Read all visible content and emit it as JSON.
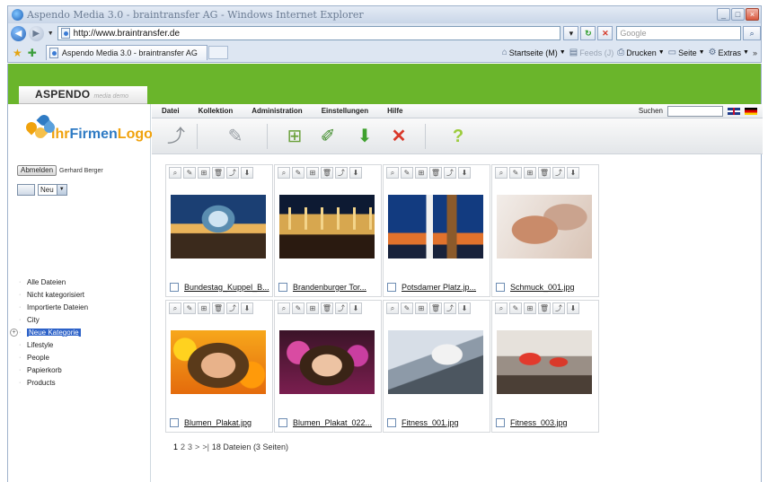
{
  "window": {
    "title": "Aspendo Media 3.0 - braintransfer AG - Windows Internet Explorer",
    "controls": {
      "minimize": "_",
      "maximize": "□",
      "close": "×"
    }
  },
  "browser": {
    "url": "http://www.braintransfer.de",
    "search_placeholder": "Google",
    "tab_title": "Aspendo Media 3.0 - braintransfer AG",
    "commands": {
      "home": "Startseite (M)",
      "feeds": "Feeds (J)",
      "print": "Drucken",
      "page": "Seite",
      "extras": "Extras"
    }
  },
  "app": {
    "brand": "ASPENDO",
    "brand_sub": "media demo",
    "logo": {
      "ihr": "Ihr",
      "firmen": "Firmen",
      "logo": "Logo"
    },
    "user": {
      "logout_label": "Abmelden",
      "name": "Gerhard Berger"
    },
    "new_select": "Neu",
    "menu": [
      "Datei",
      "Kollektion",
      "Administration",
      "Einstellungen",
      "Hilfe"
    ],
    "search_label": "Suchen",
    "tree": [
      {
        "label": "Alle Dateien",
        "selected": false
      },
      {
        "label": "Nicht kategorisiert",
        "selected": false
      },
      {
        "label": "Importierte Dateien",
        "selected": false
      },
      {
        "label": "City",
        "selected": false
      },
      {
        "label": "Neue Kategorie",
        "selected": true
      },
      {
        "label": "Lifestyle",
        "selected": false
      },
      {
        "label": "People",
        "selected": false
      },
      {
        "label": "Papierkorb",
        "selected": false
      },
      {
        "label": "Products",
        "selected": false
      }
    ],
    "files": [
      {
        "name": "Bundestag_Kuppel_B...",
        "thumb": "bundestag-dome-photo"
      },
      {
        "name": "Brandenburger Tor...",
        "thumb": "brandenburg-gate-photo"
      },
      {
        "name": "Potsdamer Platz.jp...",
        "thumb": "potsdamer-platz-photo"
      },
      {
        "name": "Schmuck_001.jpg",
        "thumb": "jewelry-photo"
      },
      {
        "name": "Blumen_Plakat.jpg",
        "thumb": "flowers-portrait-photo"
      },
      {
        "name": "Blumen_Plakat_022...",
        "thumb": "flowers-portrait-2-photo"
      },
      {
        "name": "Fitness_001.jpg",
        "thumb": "fitness-cycling-photo"
      },
      {
        "name": "Fitness_003.jpg",
        "thumb": "fitness-class-photo"
      }
    ],
    "pager": {
      "current": "1",
      "pages": [
        "2",
        "3"
      ],
      "next": ">",
      "last": ">|",
      "summary": "18 Dateien (3 Seiten)"
    }
  },
  "colors": {
    "brand_green": "#6ab52b",
    "selection_blue": "#2d62c8",
    "logo_orange": "#f0a20d",
    "logo_blue": "#2f7bc4"
  }
}
